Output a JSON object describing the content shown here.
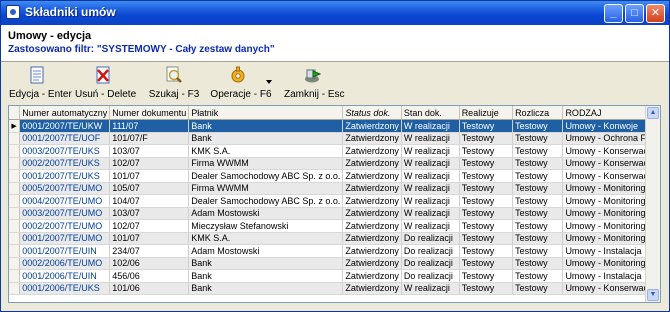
{
  "window": {
    "title": "Składniki umów"
  },
  "header": {
    "line1": "Umowy - edycja",
    "line2": "Zastosowano filtr: \"SYSTEMOWY - Cały zestaw danych\""
  },
  "toolbar": {
    "edit": "Edycja - Enter",
    "delete": "Usuń - Delete",
    "search": "Szukaj - F3",
    "operations": "Operacje - F6",
    "close": "Zamknij - Esc"
  },
  "table": {
    "columns": [
      "Numer automatyczny",
      "Numer dokumentu",
      "Płatnik",
      "Status dok.",
      "Stan dok.",
      "Realizuje",
      "Rozlicza",
      "RODZAJ"
    ],
    "rows": [
      [
        "0001/2007/TE/UKW",
        "111/07",
        "Bank",
        "Zatwierdzony",
        "W realizacji",
        "Testowy",
        "Testowy",
        "Umowy - Konwoje"
      ],
      [
        "0001/2007/TE/UOF",
        "101/07/F",
        "Bank",
        "Zatwierdzony",
        "W realizacji",
        "Testowy",
        "Testowy",
        "Umowy - Ochrona Fizy"
      ],
      [
        "0003/2007/TE/UKS",
        "103/07",
        "KMK S.A.",
        "Zatwierdzony",
        "W realizacji",
        "Testowy",
        "Testowy",
        "Umowy - Konserwacja"
      ],
      [
        "0002/2007/TE/UKS",
        "102/07",
        "Firma WWMM",
        "Zatwierdzony",
        "W realizacji",
        "Testowy",
        "Testowy",
        "Umowy - Konserwacja"
      ],
      [
        "0001/2007/TE/UKS",
        "101/07",
        "Dealer Samochodowy ABC Sp. z o.o.",
        "Zatwierdzony",
        "W realizacji",
        "Testowy",
        "Testowy",
        "Umowy - Konserwacja"
      ],
      [
        "0005/2007/TE/UMO",
        "105/07",
        "Firma WWMM",
        "Zatwierdzony",
        "W realizacji",
        "Testowy",
        "Testowy",
        "Umowy - Monitoring"
      ],
      [
        "0004/2007/TE/UMO",
        "104/07",
        "Dealer Samochodowy ABC Sp. z o.o.",
        "Zatwierdzony",
        "W realizacji",
        "Testowy",
        "Testowy",
        "Umowy - Monitoring"
      ],
      [
        "0003/2007/TE/UMO",
        "103/07",
        "Adam Mostowski",
        "Zatwierdzony",
        "W realizacji",
        "Testowy",
        "Testowy",
        "Umowy - Monitoring"
      ],
      [
        "0002/2007/TE/UMO",
        "102/07",
        "Mieczysław Stefanowski",
        "Zatwierdzony",
        "W realizacji",
        "Testowy",
        "Testowy",
        "Umowy - Monitoring"
      ],
      [
        "0001/2007/TE/UMO",
        "101/07",
        "KMK S.A.",
        "Zatwierdzony",
        "Do realizacji",
        "Testowy",
        "Testowy",
        "Umowy - Monitoring"
      ],
      [
        "0001/2007/TE/UIN",
        "234/07",
        "Adam Mostowski",
        "Zatwierdzony",
        "Do realizacji",
        "Testowy",
        "Testowy",
        "Umowy - Instalacja"
      ],
      [
        "0002/2006/TE/UMO",
        "102/06",
        "Bank",
        "Zatwierdzony",
        "Do realizacji",
        "Testowy",
        "Testowy",
        "Umowy - Monitoring"
      ],
      [
        "0001/2006/TE/UIN",
        "456/06",
        "Bank",
        "Zatwierdzony",
        "Do realizacji",
        "Testowy",
        "Testowy",
        "Umowy - Instalacja"
      ],
      [
        "0001/2006/TE/UKS",
        "101/06",
        "Bank",
        "Zatwierdzony",
        "W realizacji",
        "Testowy",
        "Testowy",
        "Umowy - Konserwacja"
      ]
    ]
  }
}
